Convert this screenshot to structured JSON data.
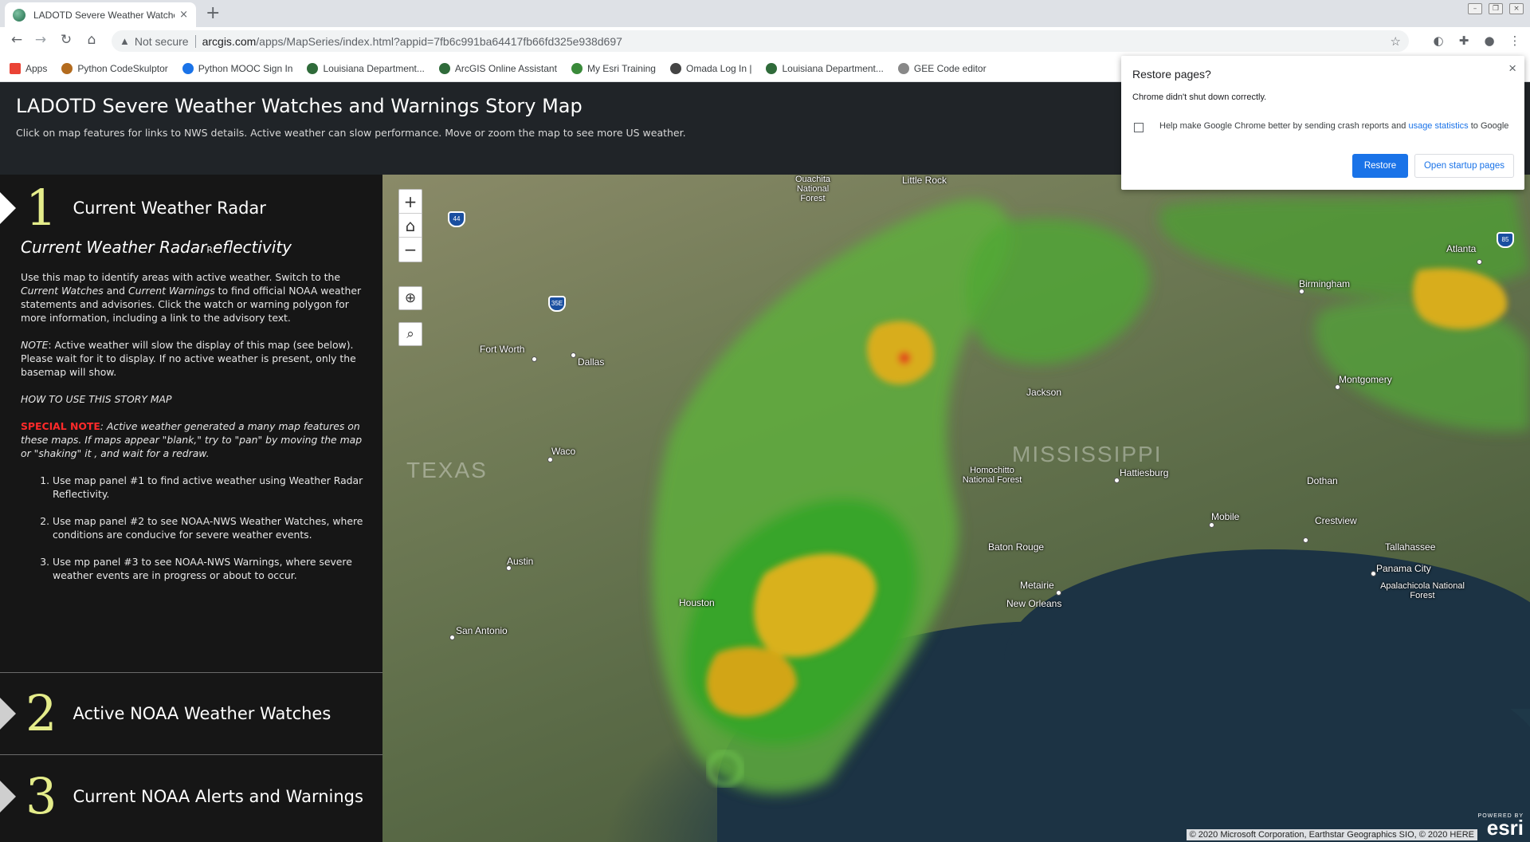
{
  "browser": {
    "tab": {
      "title": "LADOTD Severe Weather Watches and Warnings Story Map",
      "close_glyph": "×"
    },
    "new_tab_glyph": "+",
    "address": {
      "security_label": "Not secure",
      "host": "arcgis.com",
      "path": "/apps/MapSeries/index.html?appid=7fb6c991ba64417fb66fd325e938d697"
    },
    "bookmarks": [
      {
        "label": "Apps",
        "color": "#ea4335"
      },
      {
        "label": "Python CodeSkulptor",
        "color": "#b36b1e"
      },
      {
        "label": "Python MOOC Sign In",
        "color": "#1a73e8"
      },
      {
        "label": "Louisiana Department...",
        "color": "#2f6b3a"
      },
      {
        "label": "ArcGIS Online Assistant",
        "color": "#2f6b3a"
      },
      {
        "label": "My Esri Training",
        "color": "#3a8a3a"
      },
      {
        "label": "Omada Log In |",
        "color": "#444444"
      },
      {
        "label": "Louisiana Department...",
        "color": "#2f6b3a"
      },
      {
        "label": "GEE Code editor",
        "color": "#888888"
      }
    ]
  },
  "header": {
    "title": "LADOTD Severe Weather Watches and Warnings Story Map",
    "subtitle": "Click on map features for links to NWS details. Active weather can slow performance. Move or zoom the map to see more US weather."
  },
  "sections": [
    {
      "number": "1",
      "label": "Current Weather Radar"
    },
    {
      "number": "2",
      "label": "Active NOAA Weather Watches"
    },
    {
      "number": "3",
      "label": "Current NOAA Alerts and Warnings"
    }
  ],
  "panel": {
    "heading_a": "Current Weather Radar",
    "heading_tiny": "R",
    "heading_b": "eflectivity",
    "p1_a": "Use this map to identify areas with active weather. Switch to the ",
    "p1_i1": "Current Watches",
    "p1_b": " and ",
    "p1_i2": "Current Warnings",
    "p1_c": " to find official NOAA weather statements and advisories. Click the watch or warning polygon for more information, including a link to the advisory text.",
    "note_label": "NOTE",
    "note_text": ": Active weather will slow the display of this map (see below). Please wait for it to display. If no active weather is present, only the basemap will show.",
    "how_to": "HOW TO USE THIS STORY MAP",
    "special_label": "SPECIAL NOTE",
    "special_text": ": Active weather generated a many map features on these maps. If maps appear \"blank,\" try to \"pan\" by moving the map or \"shaking\" it , and wait for a redraw.",
    "steps": [
      "Use map panel #1 to find active weather using Weather Radar Reflectivity.",
      "Use map panel #2 to see NOAA-NWS Weather Watches, where conditions are conducive for severe weather events.",
      "Use mp panel #3 to see NOAA-NWS Warnings, where severe weather events are in progress or about to occur."
    ]
  },
  "map": {
    "zoom_in": "+",
    "zoom_out": "−",
    "places": [
      "Fort Worth",
      "Dallas",
      "Waco",
      "Austin",
      "San Antonio",
      "Houston",
      "Baton Rouge",
      "Metairie",
      "New Orleans",
      "Hattiesburg",
      "Mobile",
      "Dothan",
      "Crestview",
      "Tallahassee",
      "Panama City",
      "Birmingham",
      "Montgomery",
      "Atlanta",
      "Little Rock",
      "Jackson",
      "Apalachicola National Forest",
      "Homochitto National Forest",
      "Ouachita National Forest"
    ],
    "states": [
      "TEXAS",
      "MISSISSIPPI"
    ],
    "shields": [
      "44",
      "35E",
      "85"
    ],
    "attribution": "© 2020 Microsoft Corporation, Earthstar Geographics SIO, © 2020 HERE",
    "powered_by": "POWERED BY",
    "esri": "esri"
  },
  "dialog": {
    "title": "Restore pages?",
    "message": "Chrome didn't shut down correctly.",
    "help_pre": "Help make Google Chrome better by sending crash reports and ",
    "help_link": "usage statistics",
    "help_post": " to Google",
    "restore_label": "Restore",
    "startup_label": "Open startup pages"
  }
}
